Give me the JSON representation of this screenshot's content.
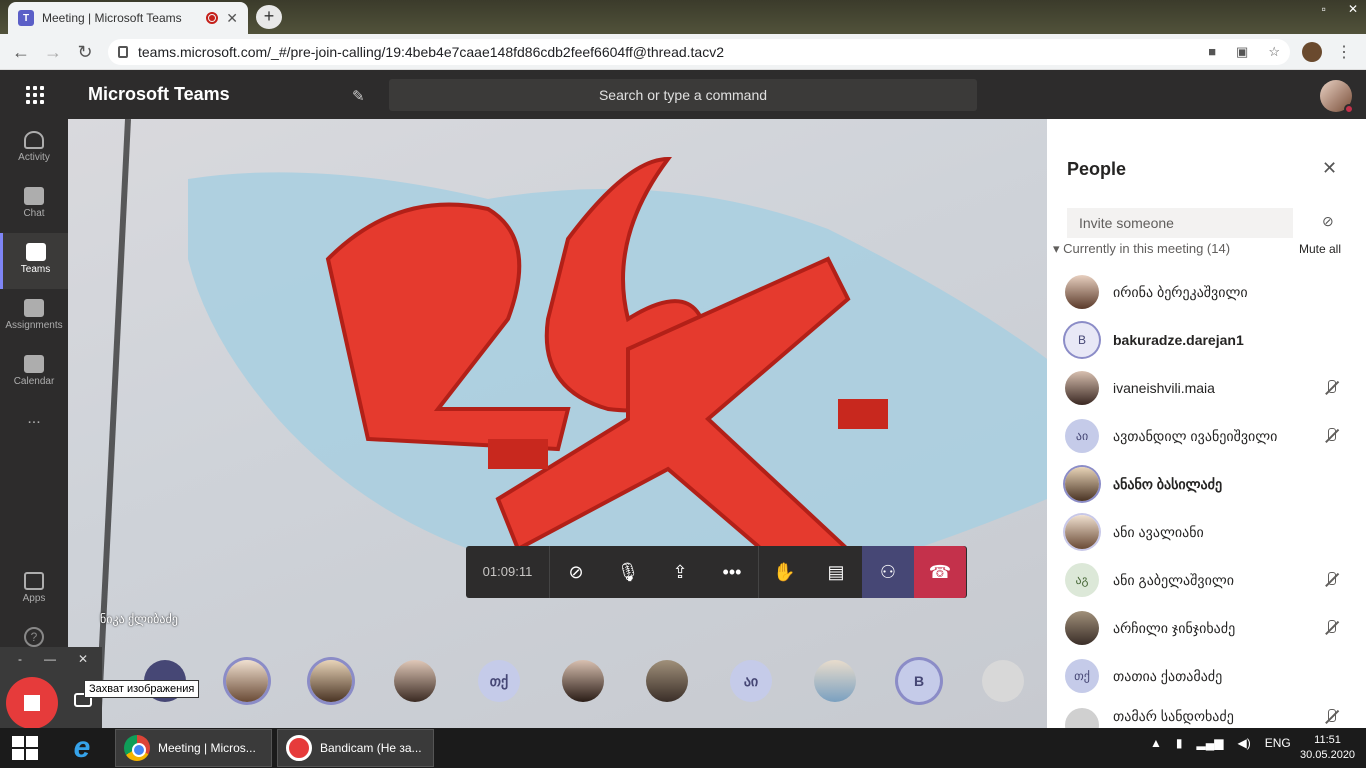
{
  "browser": {
    "tab_title": "Meeting | Microsoft Teams",
    "tab_close": "✕",
    "new_tab": "+",
    "url": "teams.microsoft.com/_#/pre-join-calling/19:4beb4e7caae148fd86cdb2feef6604ff@thread.tacv2"
  },
  "header": {
    "app_name": "Microsoft Teams",
    "search_placeholder": "Search or type a command"
  },
  "rail": {
    "items": [
      {
        "label": "Activity"
      },
      {
        "label": "Chat"
      },
      {
        "label": "Teams"
      },
      {
        "label": "Assignments"
      },
      {
        "label": "Calendar"
      },
      {
        "label": "..."
      },
      {
        "label": "Apps"
      }
    ]
  },
  "video": {
    "speaker_name": "ნიკა ქლიბაძე"
  },
  "controls": {
    "timer": "01:09:11"
  },
  "thumbnails": [
    "თქ",
    "აი",
    "B"
  ],
  "bandicam": {
    "tooltip": "Захват изображения",
    "bar_min": "-",
    "bar_restore": "—",
    "bar_close": "✕"
  },
  "people_panel": {
    "title": "People",
    "invite_placeholder": "Invite someone",
    "section_label": "Currently in this meeting (14)",
    "mute_all": "Mute all",
    "participants": [
      {
        "name": "ირინა ბერეკაშვილი",
        "initials": "",
        "bold": false,
        "muted": false
      },
      {
        "name": "bakuradze.darejan1",
        "initials": "B",
        "bold": true,
        "muted": false
      },
      {
        "name": "ivaneishvili.maia",
        "initials": "",
        "bold": false,
        "muted": true
      },
      {
        "name": "ავთანდილ ივანეიშვილი",
        "initials": "აი",
        "bold": false,
        "muted": true
      },
      {
        "name": "ანანო ბასილაძე",
        "initials": "",
        "bold": true,
        "muted": false
      },
      {
        "name": "ანი ავალიანი",
        "initials": "",
        "bold": false,
        "muted": false
      },
      {
        "name": "ანი გაბელაშვილი",
        "initials": "აგ",
        "bold": false,
        "muted": true
      },
      {
        "name": "არჩილი ჯინჯიხაძე",
        "initials": "",
        "bold": false,
        "muted": true
      },
      {
        "name": "თათია ქათამაძე",
        "initials": "თქ",
        "bold": false,
        "muted": false
      },
      {
        "name": "თამარ სანდოხაძე",
        "initials": "",
        "bold": false,
        "muted": true
      }
    ]
  },
  "taskbar": {
    "items": [
      {
        "label": "Meeting | Micros..."
      },
      {
        "label": "Bandicam (Не за..."
      }
    ],
    "language": "ENG",
    "time": "11:51",
    "date": "30.05.2020"
  },
  "colors": {
    "accent": "#5b5fc7",
    "hangup": "#c4314b",
    "status_busy": "#c4314b"
  }
}
